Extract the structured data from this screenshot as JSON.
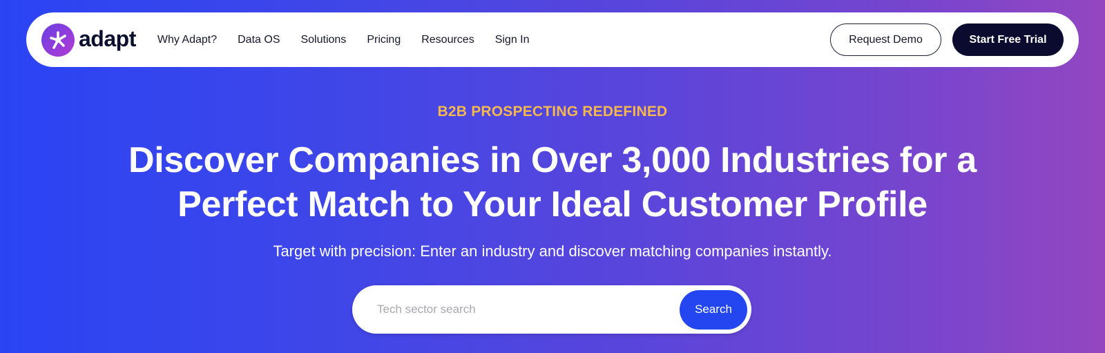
{
  "brand": {
    "name": "adapt",
    "icon": "adapt-logo-icon"
  },
  "nav": {
    "links": [
      "Why Adapt?",
      "Data OS",
      "Solutions",
      "Pricing",
      "Resources",
      "Sign In"
    ],
    "request_demo_label": "Request Demo",
    "start_trial_label": "Start Free Trial"
  },
  "hero": {
    "eyebrow": "B2B PROSPECTING REDEFINED",
    "headline_line1": "Discover Companies in Over 3,000 Industries for a",
    "headline_line2": "Perfect Match to Your Ideal Customer Profile",
    "subheadline": "Target with precision: Enter an industry and discover matching companies instantly."
  },
  "search": {
    "placeholder": "Tech sector search",
    "value": "",
    "button_label": "Search"
  },
  "colors": {
    "gradient_start": "#2a44f4",
    "gradient_end": "#9446c0",
    "eyebrow": "#f5b84e",
    "primary_button": "#2446f0",
    "dark_button": "#0a0b2e"
  }
}
